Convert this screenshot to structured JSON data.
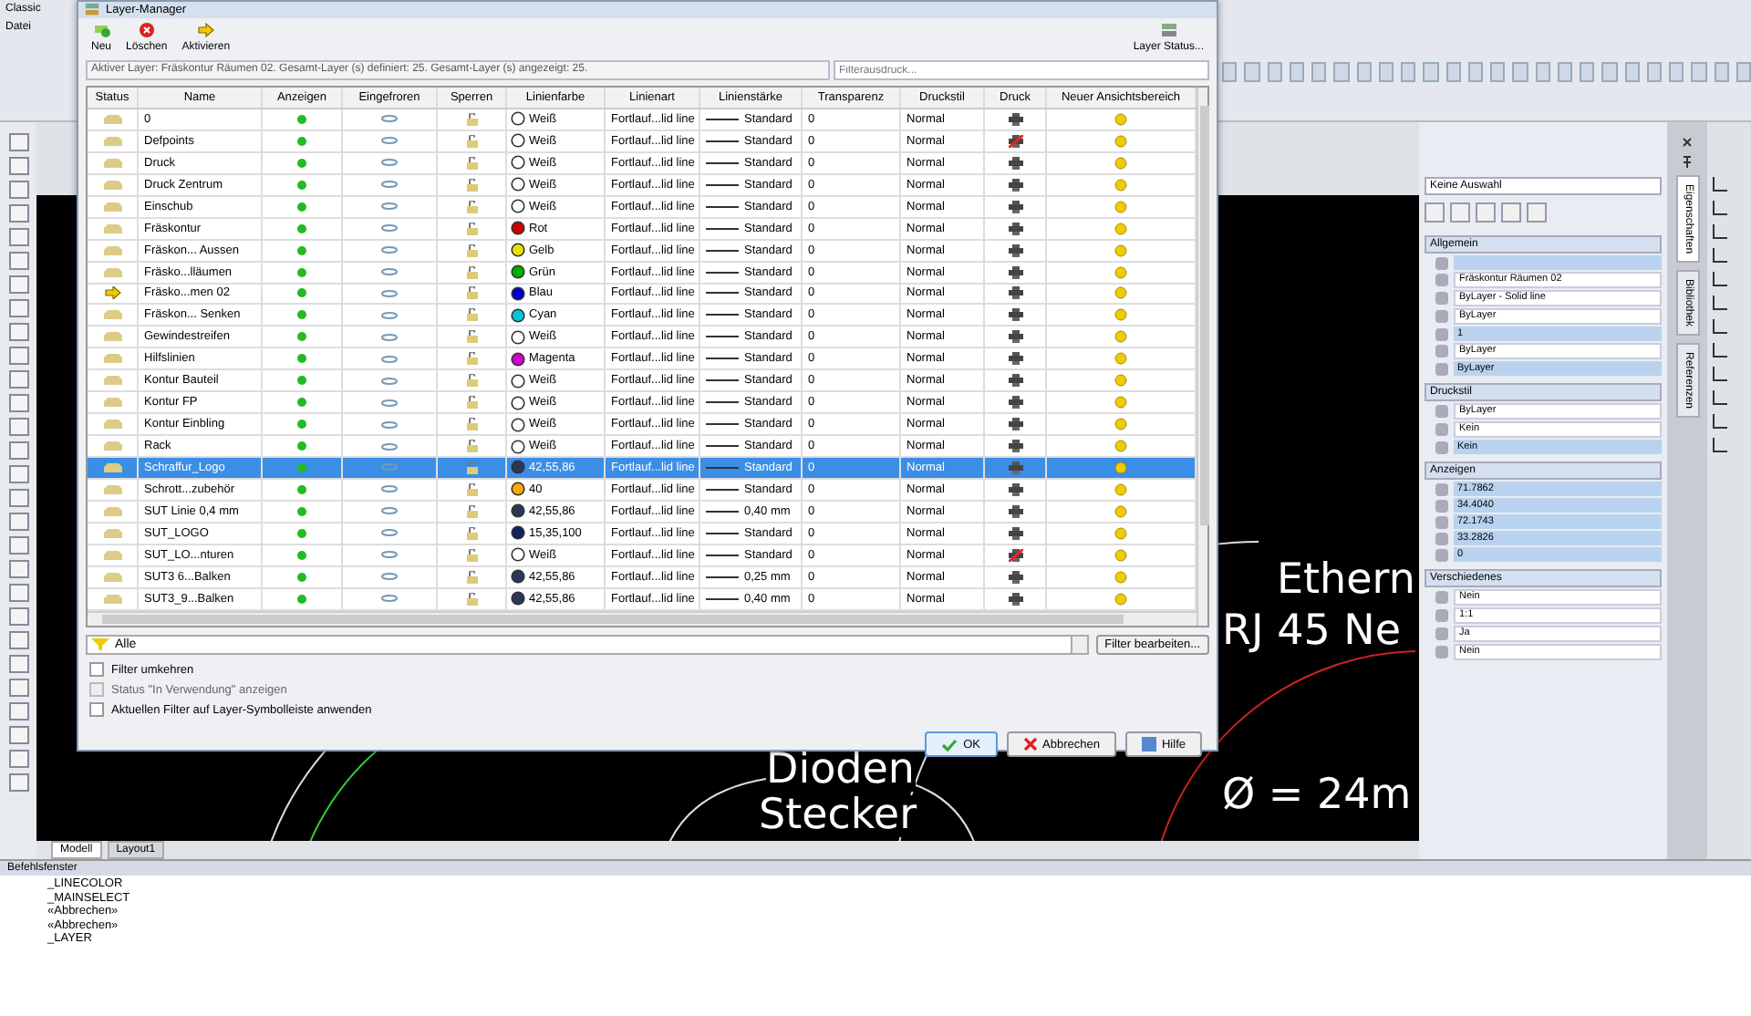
{
  "app": {
    "workspace": "Classic",
    "menu": [
      "Datei"
    ]
  },
  "drawing": {
    "texts": [
      "Ethern",
      "RJ 45 Ne",
      "Dioden",
      "Stecker",
      "Ø = 24m"
    ],
    "tabs": [
      {
        "label": "Modell",
        "selected": true
      },
      {
        "label": "Layout1",
        "selected": false
      }
    ]
  },
  "command_window": {
    "title": "Befehlsfenster",
    "lines": [
      "_LINECOLOR",
      "_MAINSELECT",
      "«Abbrechen»",
      "«Abbrechen»",
      "_LAYER"
    ]
  },
  "properties": {
    "selection": "Keine Auswahl",
    "sections": [
      {
        "title": "Allgemein",
        "fields": [
          {
            "kind": "text"
          },
          {
            "value": "Fräskontur Räumen 02",
            "kind": "dropdown"
          },
          {
            "value": "ByLayer - Solid line",
            "kind": "dropdown"
          },
          {
            "value": "ByLayer",
            "kind": "dropdown"
          },
          {
            "value": "1",
            "kind": "text"
          },
          {
            "value": "ByLayer",
            "kind": "dropdown"
          },
          {
            "value": "ByLayer",
            "kind": "text"
          }
        ]
      },
      {
        "title": "Druckstil",
        "fields": [
          {
            "value": "ByLayer",
            "kind": "dropdown"
          },
          {
            "value": "Kein",
            "kind": "dropdown"
          },
          {
            "value": "Kein",
            "kind": "text"
          }
        ]
      },
      {
        "title": "Anzeigen",
        "fields": [
          {
            "value": "71.7862",
            "kind": "text"
          },
          {
            "value": "34.4040",
            "kind": "text"
          },
          {
            "value": "72.1743",
            "kind": "text"
          },
          {
            "value": "33.2826",
            "kind": "text"
          },
          {
            "value": "0",
            "kind": "text"
          }
        ]
      },
      {
        "title": "Verschiedenes",
        "fields": [
          {
            "value": "Nein",
            "kind": "dropdown"
          },
          {
            "value": "1:1",
            "kind": "dropdown"
          },
          {
            "value": "Ja",
            "kind": "dropdown"
          },
          {
            "value": "Nein",
            "kind": "dropdown"
          }
        ]
      }
    ],
    "side_tabs": [
      {
        "label": "Eigenschaften",
        "selected": true
      },
      {
        "label": "Bibliothek",
        "selected": false
      },
      {
        "label": "Referenzen",
        "selected": false
      }
    ]
  },
  "dialog": {
    "title": "Layer-Manager",
    "toolbar": [
      "Neu",
      "Löschen",
      "Aktivieren"
    ],
    "status_button": "Layer Status...",
    "info": "Aktiver Layer: Fräskontur Räumen 02. Gesamt-Layer (s) definiert: 25. Gesamt-Layer (s) angezeigt: 25.",
    "search": {
      "placeholder": "Filterausdruck..."
    },
    "columns": [
      "Status",
      "Name",
      "Anzeigen",
      "Eingefroren",
      "Sperren",
      "Linienfarbe",
      "Linienart",
      "Linienstärke",
      "Transparenz",
      "Druckstil",
      "Druck",
      "Neuer Ansichtsbereich"
    ],
    "rows": [
      {
        "current": false,
        "name": "0",
        "color": "#ffffff",
        "color_label": "Weiß",
        "linetype": "Fortlauf...lid line",
        "lineweight": "Standard",
        "transparency": "0",
        "plotstyle": "Normal",
        "plot": true,
        "selected": false
      },
      {
        "current": false,
        "name": "Defpoints",
        "color": "#ffffff",
        "color_label": "Weiß",
        "linetype": "Fortlauf...lid line",
        "lineweight": "Standard",
        "transparency": "0",
        "plotstyle": "Normal",
        "plot": false,
        "selected": false
      },
      {
        "current": false,
        "name": "Druck",
        "color": "#ffffff",
        "color_label": "Weiß",
        "linetype": "Fortlauf...lid line",
        "lineweight": "Standard",
        "transparency": "0",
        "plotstyle": "Normal",
        "plot": true,
        "selected": false
      },
      {
        "current": false,
        "name": "Druck Zentrum",
        "color": "#ffffff",
        "color_label": "Weiß",
        "linetype": "Fortlauf...lid line",
        "lineweight": "Standard",
        "transparency": "0",
        "plotstyle": "Normal",
        "plot": true,
        "selected": false
      },
      {
        "current": false,
        "name": "Einschub",
        "color": "#ffffff",
        "color_label": "Weiß",
        "linetype": "Fortlauf...lid line",
        "lineweight": "Standard",
        "transparency": "0",
        "plotstyle": "Normal",
        "plot": true,
        "selected": false
      },
      {
        "current": false,
        "name": "Fräskontur",
        "color": "#d00000",
        "color_label": "Rot",
        "linetype": "Fortlauf...lid line",
        "lineweight": "Standard",
        "transparency": "0",
        "plotstyle": "Normal",
        "plot": true,
        "selected": false
      },
      {
        "current": false,
        "name": "Fräskon... Aussen",
        "color": "#e8e000",
        "color_label": "Gelb",
        "linetype": "Fortlauf...lid line",
        "lineweight": "Standard",
        "transparency": "0",
        "plotstyle": "Normal",
        "plot": true,
        "selected": false
      },
      {
        "current": false,
        "name": "Fräsko...lläumen",
        "color": "#00b000",
        "color_label": "Grün",
        "linetype": "Fortlauf...lid line",
        "lineweight": "Standard",
        "transparency": "0",
        "plotstyle": "Normal",
        "plot": true,
        "selected": false
      },
      {
        "current": true,
        "name": "Fräsko...men 02",
        "color": "#0000d0",
        "color_label": "Blau",
        "linetype": "Fortlauf...lid line",
        "lineweight": "Standard",
        "transparency": "0",
        "plotstyle": "Normal",
        "plot": true,
        "selected": false
      },
      {
        "current": false,
        "name": "Fräskon... Senken",
        "color": "#00c8d8",
        "color_label": "Cyan",
        "linetype": "Fortlauf...lid line",
        "lineweight": "Standard",
        "transparency": "0",
        "plotstyle": "Normal",
        "plot": true,
        "selected": false
      },
      {
        "current": false,
        "name": "Gewindestreifen",
        "color": "#ffffff",
        "color_label": "Weiß",
        "linetype": "Fortlauf...lid line",
        "lineweight": "Standard",
        "transparency": "0",
        "plotstyle": "Normal",
        "plot": true,
        "selected": false
      },
      {
        "current": false,
        "name": "Hilfslinien",
        "color": "#d000d0",
        "color_label": "Magenta",
        "linetype": "Fortlauf...lid line",
        "lineweight": "Standard",
        "transparency": "0",
        "plotstyle": "Normal",
        "plot": true,
        "selected": false
      },
      {
        "current": false,
        "name": "Kontur Bauteil",
        "color": "#ffffff",
        "color_label": "Weiß",
        "linetype": "Fortlauf...lid line",
        "lineweight": "Standard",
        "transparency": "0",
        "plotstyle": "Normal",
        "plot": true,
        "selected": false
      },
      {
        "current": false,
        "name": "Kontur FP",
        "color": "#ffffff",
        "color_label": "Weiß",
        "linetype": "Fortlauf...lid line",
        "lineweight": "Standard",
        "transparency": "0",
        "plotstyle": "Normal",
        "plot": true,
        "selected": false
      },
      {
        "current": false,
        "name": "Kontur Einbling",
        "color": "#ffffff",
        "color_label": "Weiß",
        "linetype": "Fortlauf...lid line",
        "lineweight": "Standard",
        "transparency": "0",
        "plotstyle": "Normal",
        "plot": true,
        "selected": false
      },
      {
        "current": false,
        "name": "Rack",
        "color": "#ffffff",
        "color_label": "Weiß",
        "linetype": "Fortlauf...lid line",
        "lineweight": "Standard",
        "transparency": "0",
        "plotstyle": "Normal",
        "plot": true,
        "selected": false
      },
      {
        "current": false,
        "name": "Schraffur_Logo",
        "color": "#2a3756",
        "color_label": "42,55,86",
        "linetype": "Fortlauf...lid line",
        "lineweight": "Standard",
        "transparency": "0",
        "plotstyle": "Normal",
        "plot": true,
        "selected": true
      },
      {
        "current": false,
        "name": "Schrott...zubehör",
        "color": "#ffaa00",
        "color_label": "40",
        "linetype": "Fortlauf...lid line",
        "lineweight": "Standard",
        "transparency": "0",
        "plotstyle": "Normal",
        "plot": true,
        "selected": false
      },
      {
        "current": false,
        "name": "SUT Linie 0,4 mm",
        "color": "#2a3756",
        "color_label": "42,55,86",
        "linetype": "Fortlauf...lid line",
        "lineweight": "0,40 mm",
        "transparency": "0",
        "plotstyle": "Normal",
        "plot": true,
        "selected": false
      },
      {
        "current": false,
        "name": "SUT_LOGO",
        "color": "#0f2364",
        "color_label": "15,35,100",
        "linetype": "Fortlauf...lid line",
        "lineweight": "Standard",
        "transparency": "0",
        "plotstyle": "Normal",
        "plot": true,
        "selected": false
      },
      {
        "current": false,
        "name": "SUT_LO...nturen",
        "color": "#ffffff",
        "color_label": "Weiß",
        "linetype": "Fortlauf...lid line",
        "lineweight": "Standard",
        "transparency": "0",
        "plotstyle": "Normal",
        "plot": false,
        "selected": false
      },
      {
        "current": false,
        "name": "SUT3 6...Balken",
        "color": "#2a3756",
        "color_label": "42,55,86",
        "linetype": "Fortlauf...lid line",
        "lineweight": "0,25 mm",
        "transparency": "0",
        "plotstyle": "Normal",
        "plot": true,
        "selected": false
      },
      {
        "current": false,
        "name": "SUT3_9...Balken",
        "color": "#2a3756",
        "color_label": "42,55,86",
        "linetype": "Fortlauf...lid line",
        "lineweight": "0,40 mm",
        "transparency": "0",
        "plotstyle": "Normal",
        "plot": true,
        "selected": false
      }
    ],
    "filter": {
      "value": "Alle",
      "button": "Filter bearbeiten..."
    },
    "options": [
      {
        "label": "Filter umkehren",
        "checked": false,
        "disabled": false
      },
      {
        "label": "Status \"In Verwendung\" anzeigen",
        "checked": false,
        "disabled": true
      },
      {
        "label": "Aktuellen Filter auf Layer-Symbolleiste anwenden",
        "checked": false,
        "disabled": false
      }
    ],
    "buttons": [
      {
        "label": "OK",
        "kind": "ok"
      },
      {
        "label": "Abbrechen",
        "kind": "cancel"
      },
      {
        "label": "Hilfe",
        "kind": "help"
      }
    ]
  }
}
